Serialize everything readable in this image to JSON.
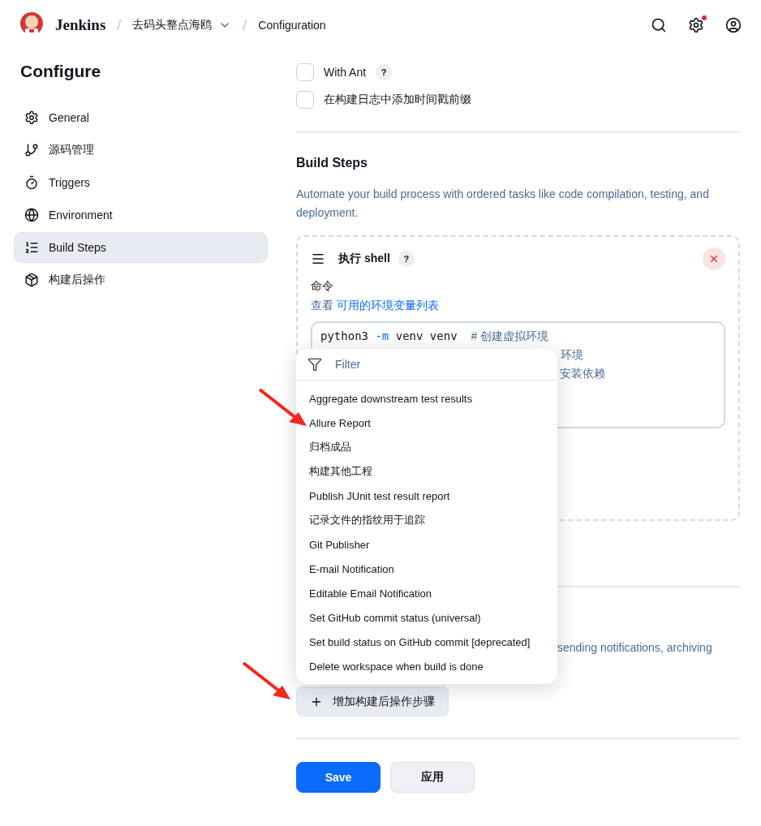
{
  "header": {
    "brand": "Jenkins",
    "breadcrumbs": [
      {
        "separator": "/",
        "label": "去码头整点海鸥",
        "has_menu": true
      },
      {
        "separator": "/",
        "label": "Configuration",
        "has_menu": false
      }
    ],
    "settings_alert": true
  },
  "sidebar": {
    "title": "Configure",
    "items": [
      {
        "label": "General",
        "selected": false
      },
      {
        "label": "源码管理",
        "selected": false
      },
      {
        "label": "Triggers",
        "selected": false
      },
      {
        "label": "Environment",
        "selected": false
      },
      {
        "label": "Build Steps",
        "selected": true
      },
      {
        "label": "构建后操作",
        "selected": false
      }
    ]
  },
  "options": [
    {
      "label": "With Ant",
      "checked": false,
      "help": "?"
    },
    {
      "label": "在构建日志中添加时间戳前缀",
      "checked": false
    }
  ],
  "build_steps": {
    "title": "Build Steps",
    "description": "Automate your build process with ordered tasks like code compilation, testing, and deployment.",
    "step": {
      "title": "执行 shell",
      "help": "?",
      "field_label": "命令",
      "env_prefix": "查看",
      "env_link": "可用的环境变量列表",
      "script_lines": [
        [
          {
            "kind": "code",
            "text": "python3 "
          },
          {
            "kind": "flag",
            "text": "-m"
          },
          {
            "kind": "code",
            "text": " venv venv  "
          },
          {
            "kind": "comment",
            "text": "# 创建虚拟环境"
          }
        ],
        [
          {
            "kind": "comment",
            "text": "环境"
          }
        ],
        [
          {
            "kind": "comment",
            "text": "安装依赖"
          }
        ]
      ]
    }
  },
  "post_build": {
    "description": "sending notifications, archiving",
    "add_button": "增加构建后操作步骤"
  },
  "dropdown": {
    "placeholder": "Filter",
    "items": [
      "Aggregate downstream test results",
      "Allure Report",
      "归档成品",
      "构建其他工程",
      "Publish JUnit test result report",
      "记录文件的指纹用于追踪",
      "Git Publisher",
      "E-mail Notification",
      "Editable Email Notification",
      "Set GitHub commit status (universal)",
      "Set build status on GitHub commit [deprecated]",
      "Delete workspace when build is done"
    ]
  },
  "actions": {
    "save": "Save",
    "apply": "应用"
  },
  "annotations": [
    {
      "kind": "arrow"
    },
    {
      "kind": "arrow"
    }
  ]
}
